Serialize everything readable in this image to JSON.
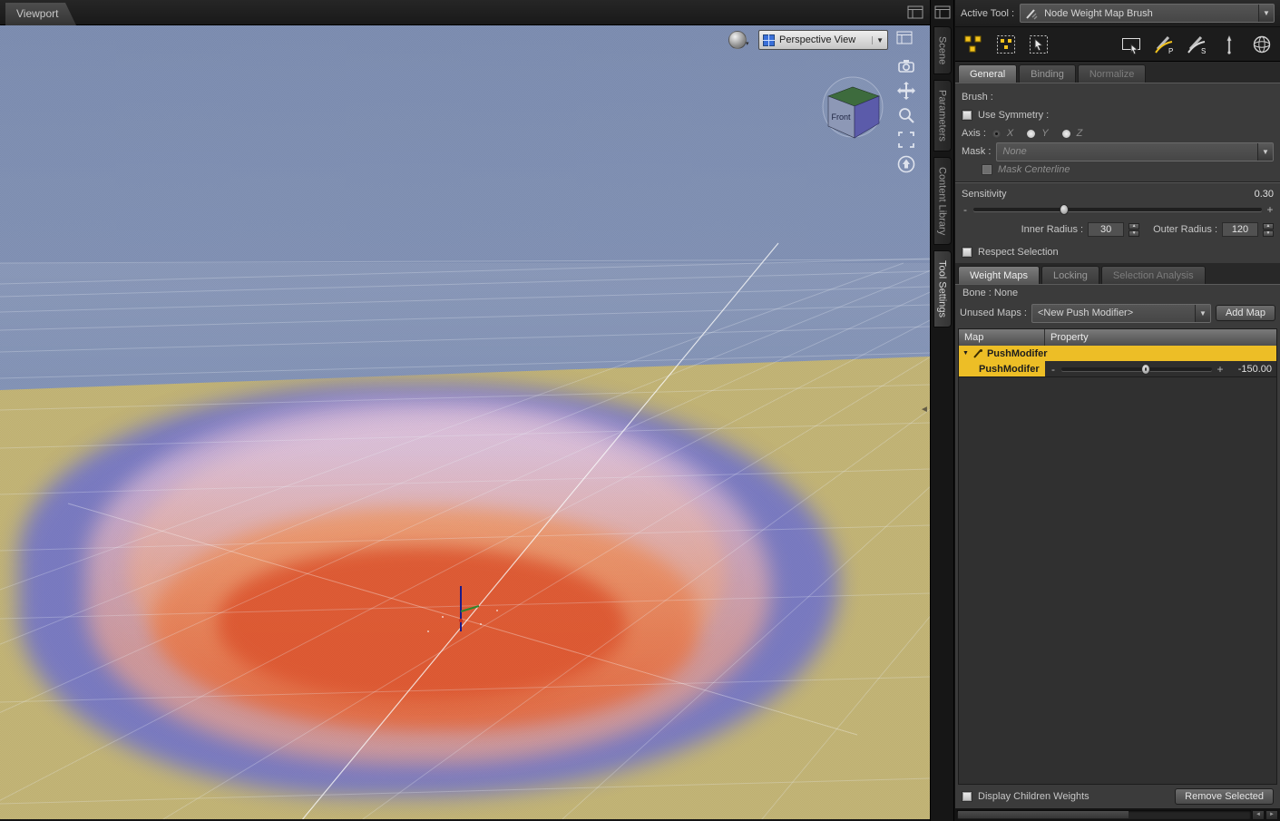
{
  "topbar": {
    "viewport_tab": "Viewport"
  },
  "viewport": {
    "view_selector": "Perspective View",
    "cube_front_label": "Front",
    "colors": {
      "sky": "#8393b6",
      "plane": "#c9ba79",
      "weight_outer": "#7678cb",
      "weight_mid": "#cbb2d8",
      "weight_core": "#e25b34"
    }
  },
  "side_tabs": {
    "items": [
      {
        "label": "Scene"
      },
      {
        "label": "Parameters"
      },
      {
        "label": "Content Library"
      },
      {
        "label": "Tool Settings"
      }
    ]
  },
  "tool_panel": {
    "active_tool_label": "Active Tool :",
    "active_tool_value": "Node Weight Map Brush",
    "tabs": {
      "general": "General",
      "binding": "Binding",
      "normalize": "Normalize"
    },
    "brush_label": "Brush :",
    "use_symmetry_label": "Use Symmetry :",
    "axis_label": "Axis :",
    "axis_x": "X",
    "axis_y": "Y",
    "axis_z": "Z",
    "mask_label": "Mask :",
    "mask_value": "None",
    "mask_centerline_label": "Mask Centerline",
    "sensitivity_label": "Sensitivity",
    "sensitivity_value": "0.30",
    "inner_radius_label": "Inner Radius :",
    "inner_radius_value": "30",
    "outer_radius_label": "Outer Radius :",
    "outer_radius_value": "120",
    "respect_selection_label": "Respect Selection",
    "section_tabs": {
      "weight_maps": "Weight Maps",
      "locking": "Locking",
      "selection_analysis": "Selection Analysis"
    },
    "bone_label": "Bone : None",
    "unused_maps_label": "Unused Maps :",
    "unused_maps_value": "<New Push Modifier>",
    "add_map_button": "Add Map",
    "table": {
      "col_map": "Map",
      "col_property": "Property",
      "parent_row": "PushModifer",
      "child_row": "PushModifer",
      "child_value": "-150.00"
    },
    "display_children_label": "Display Children Weights",
    "remove_selected_button": "Remove Selected"
  },
  "icons": {
    "paint_brush_letter": "P",
    "smooth_brush_letter": "S"
  },
  "glyphs": {
    "dropdown_arrow": "▼",
    "minus": "-",
    "plus": "+",
    "expand_triangle": "▼",
    "collapse_left": "◄",
    "scroll_left": "◄",
    "scroll_right": "►",
    "spin_up": "▲",
    "spin_down": "▼"
  }
}
